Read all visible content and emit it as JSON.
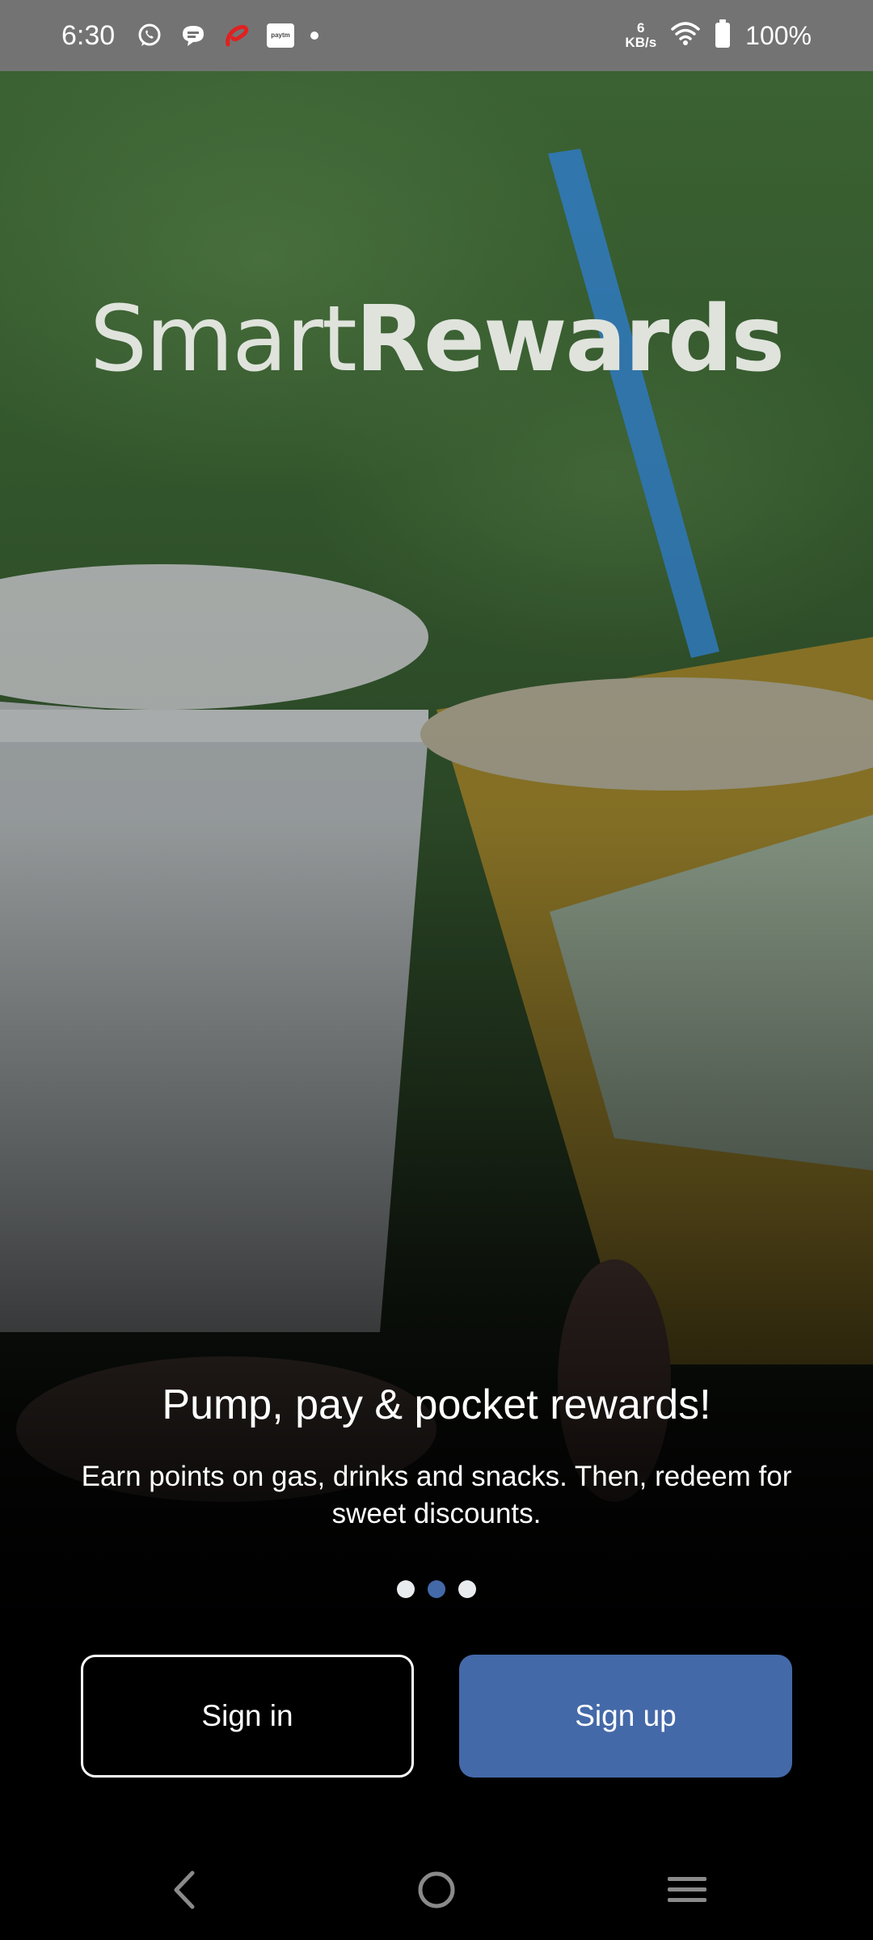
{
  "status_bar": {
    "time": "6:30",
    "net_speed_value": "6",
    "net_speed_unit": "KB/s",
    "battery_percent": "100%",
    "paytm_label": "paytm",
    "icons": [
      "whatsapp-icon",
      "chat-bubble-icon",
      "airtel-icon",
      "paytm-icon",
      "notification-dot-icon",
      "wifi-icon",
      "battery-icon"
    ]
  },
  "logo": {
    "light": "Smart",
    "bold": "Rewards",
    "color": "#dfe3dc"
  },
  "onboarding": {
    "title": "Pump, pay & pocket rewards!",
    "description": "Earn points on gas, drinks and snacks. Then, redeem for sweet discounts.",
    "page_count": 3,
    "active_page": 2
  },
  "actions": {
    "sign_in_label": "Sign in",
    "sign_up_label": "Sign up"
  },
  "nav_bar": {
    "icons": [
      "back-icon",
      "home-icon",
      "menu-icon"
    ]
  },
  "colors": {
    "accent": "#4469a8",
    "status_bar": "#737373",
    "background": "#000000"
  }
}
